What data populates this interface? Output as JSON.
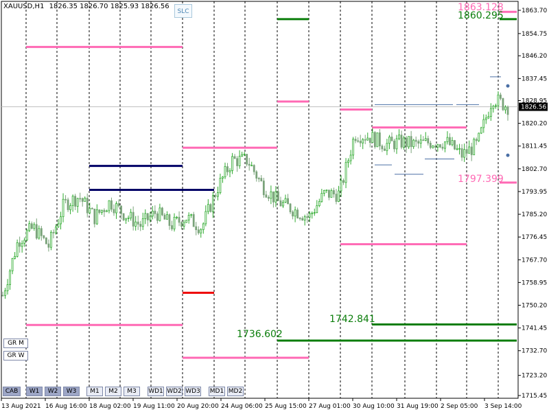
{
  "header": {
    "symbol": "XAUUSD,H1",
    "ohlc": "1826.35 1826.70 1825.93 1826.56"
  },
  "slc_button": "SLC",
  "price_axis": {
    "ticks": [
      "1863.70",
      "1854.75",
      "1846.20",
      "1837.45",
      "1828.95",
      "1820.20",
      "1811.45",
      "1802.70",
      "1793.95",
      "1785.20",
      "1776.45",
      "1767.70",
      "1758.95",
      "1750.20",
      "1741.45",
      "1732.70",
      "1723.20",
      "1715.45"
    ],
    "current_price": "1826.56"
  },
  "time_axis": {
    "ticks": [
      "13 Aug 2021",
      "16 Aug 16:00",
      "18 Aug 02:00",
      "19 Aug 11:00",
      "20 Aug 20:00",
      "24 Aug 06:00",
      "25 Aug 15:00",
      "27 Aug 01:00",
      "30 Aug 10:00",
      "31 Aug 19:00",
      "2 Sep 05:00",
      "3 Sep 14:00"
    ]
  },
  "levels": {
    "top_pink": "1863.128",
    "top_green": "1860.295",
    "mid_pink": "1797.399",
    "green_a": "1742.841",
    "green_b": "1736.602"
  },
  "side_buttons": [
    "GR M",
    "GR W"
  ],
  "bottom_buttons": [
    "CAB",
    "W1",
    "W2",
    "W3",
    "M1",
    "M2",
    "M3",
    "WD1",
    "WD2",
    "WD3",
    "MD1",
    "MD2"
  ],
  "colors": {
    "pink": "#ff69b4",
    "green": "#0a7d0a",
    "navy": "#000066",
    "red": "#ee0000",
    "candle_up": "#2eaa2e",
    "candle_down": "#7aa37a",
    "grid": "#000000"
  },
  "chart_data": {
    "type": "candlestick",
    "symbol": "XAUUSD",
    "timeframe": "H1",
    "ylim": [
      1715.45,
      1866.5
    ],
    "last_price": 1826.56,
    "close_path": [
      {
        "t": "13 Aug 2021",
        "v": 1754
      },
      {
        "t": "13 Aug 2021 b",
        "v": 1775
      },
      {
        "t": "14 Aug",
        "v": 1780
      },
      {
        "t": "15 Aug",
        "v": 1773
      },
      {
        "t": "16 Aug 16:00",
        "v": 1789
      },
      {
        "t": "17 Aug",
        "v": 1792
      },
      {
        "t": "17 Aug b",
        "v": 1784
      },
      {
        "t": "18 Aug 02:00",
        "v": 1790
      },
      {
        "t": "18 Aug b",
        "v": 1785
      },
      {
        "t": "19 Aug",
        "v": 1781
      },
      {
        "t": "19 Aug 11:00",
        "v": 1786
      },
      {
        "t": "19 Aug b",
        "v": 1781
      },
      {
        "t": "20 Aug",
        "v": 1784
      },
      {
        "t": "20 Aug 20:00",
        "v": 1780
      },
      {
        "t": "21 Aug",
        "v": 1795
      },
      {
        "t": "23 Aug",
        "v": 1806
      },
      {
        "t": "24 Aug 06:00",
        "v": 1806
      },
      {
        "t": "24 Aug b",
        "v": 1796
      },
      {
        "t": "25 Aug",
        "v": 1790
      },
      {
        "t": "25 Aug 15:00",
        "v": 1787
      },
      {
        "t": "26 Aug",
        "v": 1784
      },
      {
        "t": "26 Aug b",
        "v": 1793
      },
      {
        "t": "27 Aug 01:00",
        "v": 1793
      },
      {
        "t": "27 Aug b",
        "v": 1816
      },
      {
        "t": "28 Aug",
        "v": 1815
      },
      {
        "t": "30 Aug 10:00",
        "v": 1812
      },
      {
        "t": "31 Aug",
        "v": 1813
      },
      {
        "t": "31 Aug 19:00",
        "v": 1812
      },
      {
        "t": "1 Sep",
        "v": 1813
      },
      {
        "t": "2 Sep",
        "v": 1813
      },
      {
        "t": "2 Sep 05:00",
        "v": 1808
      },
      {
        "t": "2 Sep b",
        "v": 1812
      },
      {
        "t": "3 Sep",
        "v": 1830
      },
      {
        "t": "3 Sep 14:00",
        "v": 1826.56
      }
    ]
  }
}
